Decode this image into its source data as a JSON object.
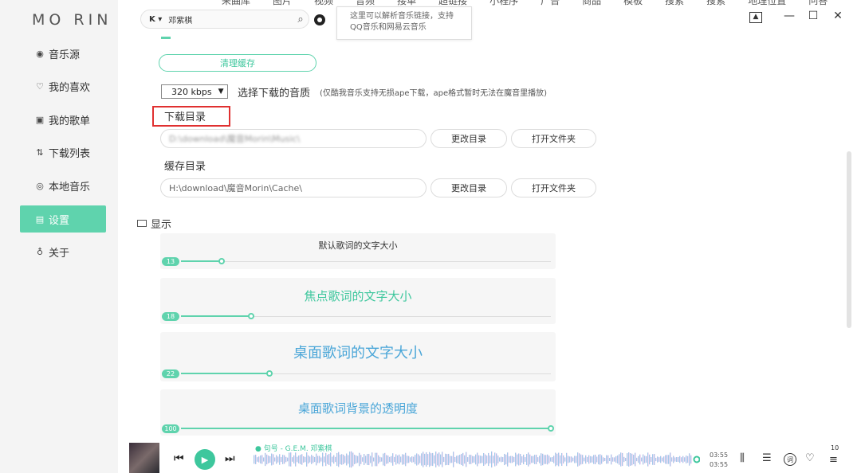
{
  "app": {
    "logo_left": "MO",
    "logo_right": "RIN"
  },
  "sidebar": {
    "items": [
      {
        "label": "音乐源",
        "icon": "record-icon"
      },
      {
        "label": "我的喜欢",
        "icon": "heart-icon"
      },
      {
        "label": "我的歌单",
        "icon": "playlist-icon"
      },
      {
        "label": "下载列表",
        "icon": "download-icon"
      },
      {
        "label": "本地音乐",
        "icon": "disc-icon"
      },
      {
        "label": "设置",
        "icon": "settings-icon",
        "active": true
      },
      {
        "label": "关于",
        "icon": "bulb-icon"
      }
    ]
  },
  "topbar": {
    "tabs": [
      "来曲库",
      "图片",
      "视频",
      "音频",
      "接单",
      "超链接",
      "小程序",
      "广告",
      "商品",
      "模板",
      "搜索",
      "搜索",
      "地理位置",
      "问答"
    ],
    "search_source": "K ▾",
    "search_text": "邓紫棋",
    "tooltip_line1": "这里可以解析音乐链接，支持",
    "tooltip_line2": "QQ音乐和网易云音乐"
  },
  "settings": {
    "clear_cache_label": "清理缓存",
    "quality_value": "320 kbps",
    "quality_label": "选择下载的音质",
    "quality_note": "(仅酷我音乐支持无损ape下载，ape格式暂时无法在魔音里播放)",
    "download_dir_label": "下载目录",
    "download_dir_value": "D:\\download\\魔音Morin\\Music\\",
    "change_dir_label": "更改目录",
    "open_folder_label": "打开文件夹",
    "cache_dir_label": "缓存目录",
    "cache_dir_value": "H:\\download\\魔音Morin\\Cache\\",
    "display_label": "显示",
    "font_sliders": [
      {
        "title": "默认歌词的文字大小",
        "value": "13",
        "level": 0.11
      },
      {
        "title": "焦点歌词的文字大小",
        "value": "18",
        "level": 0.19
      },
      {
        "title": "桌面歌词的文字大小",
        "value": "22",
        "level": 0.24
      },
      {
        "title": "桌面歌词背景的透明度",
        "value": "100",
        "level": 1.0
      }
    ]
  },
  "player": {
    "song_info": "● 句号 - G.E.M. 邓紫棋",
    "time_current": "03:55",
    "time_total": "03:55",
    "lyric_label": "词",
    "volume": "10"
  },
  "colors": {
    "accent": "#3ec79d",
    "accent_light": "#5fd3ad",
    "highlight": "#e03030"
  }
}
